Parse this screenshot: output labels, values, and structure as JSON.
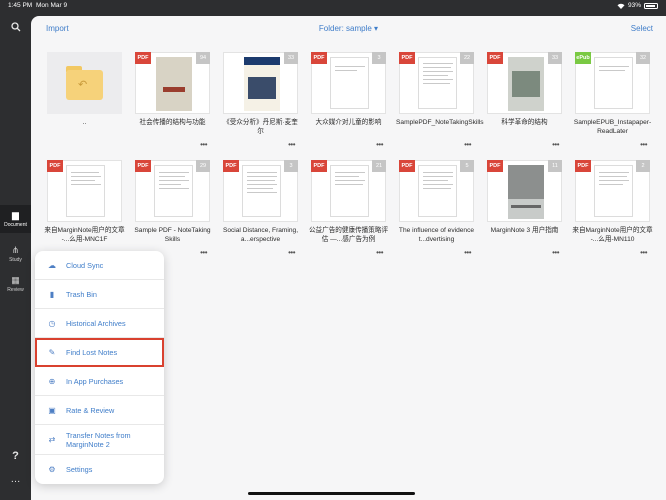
{
  "status": {
    "time": "1:45 PM",
    "date": "Mon Mar 9",
    "battery": "93%"
  },
  "sidebar": {
    "items": [
      {
        "label": "Document",
        "icon": "document-icon"
      },
      {
        "label": "Study",
        "icon": "study-icon"
      },
      {
        "label": "Review",
        "icon": "review-icon"
      }
    ],
    "help": "?",
    "more": "…"
  },
  "topbar": {
    "import": "Import",
    "folder": "Folder: sample ▾",
    "select": "Select"
  },
  "docs": [
    {
      "title": "..",
      "badge": "",
      "count": ""
    },
    {
      "title": "社会传播的结构与功能",
      "badge": "PDF",
      "count": "94"
    },
    {
      "title": "《受众分析》丹尼斯·麦奎尔",
      "badge": "PDF",
      "count": "33"
    },
    {
      "title": "大众媒介对儿童的影响",
      "badge": "PDF",
      "count": "3"
    },
    {
      "title": "SamplePDF_NoteTakingSkills",
      "badge": "PDF",
      "count": "22"
    },
    {
      "title": "科学革命的结构",
      "badge": "PDF",
      "count": "33"
    },
    {
      "title": "SampleEPUB_Instapaper-ReadLater",
      "badge": "ePub",
      "count": "32"
    },
    {
      "title": "来自MarginNote用户的文章 -...么用-MNC1F",
      "badge": "PDF",
      "count": ""
    },
    {
      "title": "Sample PDF - NoteTaking Skills",
      "badge": "PDF",
      "count": "29"
    },
    {
      "title": "Social Distance, Framing, a...erspective",
      "badge": "PDF",
      "count": "3"
    },
    {
      "title": "公益广告的健康传播策略评估 —...感广告为例",
      "badge": "PDF",
      "count": "21"
    },
    {
      "title": "The influence of evidence t...dvertising",
      "badge": "PDF",
      "count": "5"
    },
    {
      "title": "MarginNote 3 用户指南",
      "badge": "PDF",
      "count": "11"
    },
    {
      "title": "来自MarginNote用户的文章 -...么用-MN110",
      "badge": "PDF",
      "count": "2"
    }
  ],
  "menu": [
    {
      "label": "Cloud Sync",
      "icon": "cloud-icon"
    },
    {
      "label": "Trash Bin",
      "icon": "trash-icon"
    },
    {
      "label": "Historical Archives",
      "icon": "history-icon"
    },
    {
      "label": "Find Lost Notes",
      "icon": "magic-wand-icon"
    },
    {
      "label": "In App Purchases",
      "icon": "cart-icon"
    },
    {
      "label": "Rate & Review",
      "icon": "star-icon"
    },
    {
      "label": "Transfer Notes from MarginNote 2",
      "icon": "transfer-icon"
    },
    {
      "label": "Settings",
      "icon": "gear-icon"
    }
  ],
  "colors": {
    "accent": "#3f7dc9",
    "pdf_badge": "#d9463a",
    "epub_badge": "#7ac943",
    "highlight": "#d9412f"
  }
}
